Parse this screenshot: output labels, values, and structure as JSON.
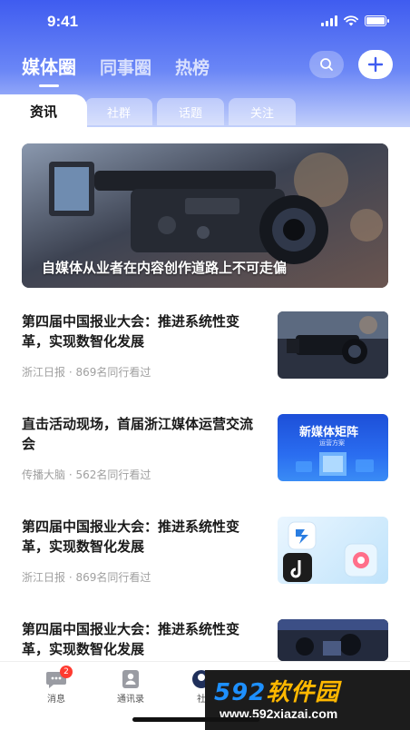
{
  "status_bar": {
    "time": "9:41"
  },
  "top_tabs": [
    {
      "label": "媒体圈",
      "active": true
    },
    {
      "label": "同事圈",
      "active": false
    },
    {
      "label": "热榜",
      "active": false
    }
  ],
  "sub_tabs": [
    {
      "label": "资讯",
      "active": true
    },
    {
      "label": "社群",
      "active": false
    },
    {
      "label": "话题",
      "active": false
    },
    {
      "label": "关注",
      "active": false
    }
  ],
  "banner": {
    "caption": "自媒体从业者在内容创作道路上不可走偏"
  },
  "news": [
    {
      "title": "第四届中国报业大会：推进系统性变革，实现数智化发展",
      "source": "浙江日报",
      "views": "869名同行看过",
      "thumb": "camera"
    },
    {
      "title": "直击活动现场，首届浙江媒体运营交流会",
      "source": "传播大脑",
      "views": "562名同行看过",
      "thumb": "new-media",
      "thumb_text": "新媒体矩阵",
      "thumb_subtext": "运营方案"
    },
    {
      "title": "第四届中国报业大会：推进系统性变革，实现数智化发展",
      "source": "浙江日报",
      "views": "869名同行看过",
      "thumb": "apps"
    },
    {
      "title": "第四届中国报业大会：推进系统性变革，实现数智化发展",
      "source": "",
      "views": "",
      "thumb": "stage"
    }
  ],
  "meta_separator": "·",
  "bottom_nav": [
    {
      "label": "消息",
      "icon": "message-icon",
      "badge": "2"
    },
    {
      "label": "通讯录",
      "icon": "contacts-icon",
      "badge": ""
    },
    {
      "label": "社",
      "icon": "community-icon",
      "badge": ""
    }
  ],
  "watermark": {
    "top": "592软件园",
    "bottom": "www.592xiazai.com"
  },
  "colors": {
    "header_start": "#3f5cf0",
    "header_end": "#c3d0fb",
    "badge": "#ff3b30"
  }
}
